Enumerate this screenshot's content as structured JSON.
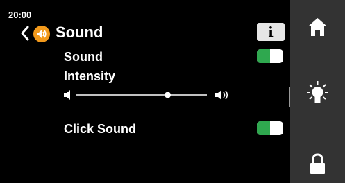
{
  "status": {
    "time": "20:00"
  },
  "header": {
    "title": "Sound",
    "back_icon": "chevron-left-icon",
    "title_icon": "speaker-icon",
    "info_label": "i"
  },
  "settings": {
    "sound": {
      "label": "Sound",
      "enabled": true
    },
    "intensity": {
      "label": "Intensity",
      "level": 0.7
    },
    "click_sound": {
      "label": "Click Sound",
      "enabled": true
    }
  },
  "nav": {
    "items": [
      {
        "icon": "home-icon"
      },
      {
        "icon": "light-bulb-icon"
      },
      {
        "icon": "lock-icon"
      }
    ]
  },
  "colors": {
    "background": "#000000",
    "nav_background": "#333333",
    "accent_orange": "#f39a1c",
    "toggle_on": "#2fa84f"
  }
}
